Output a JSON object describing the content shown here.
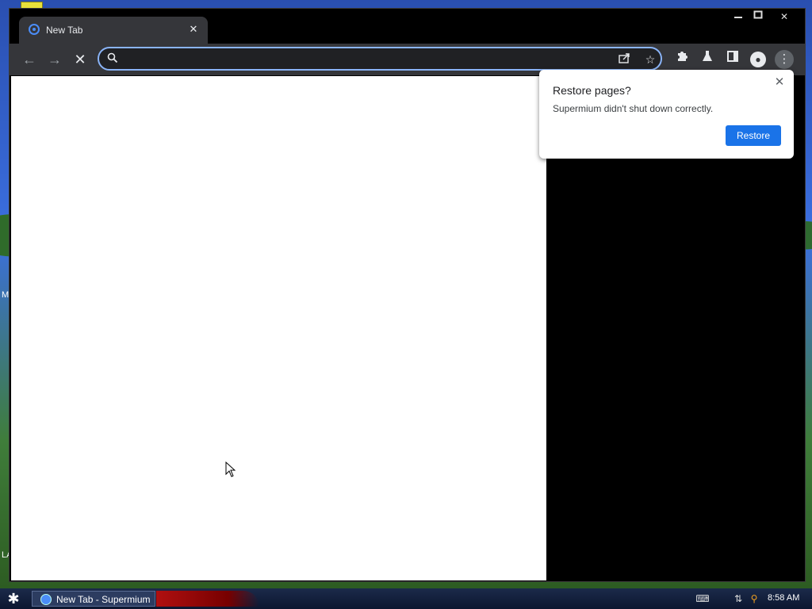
{
  "desktop": {
    "edge_labels": [
      "M",
      "LA"
    ]
  },
  "browser": {
    "tab": {
      "title": "New Tab",
      "favicon": "supermium-icon"
    },
    "window_controls": {
      "minimize_icon": "minimize-icon",
      "maximize_icon": "maximize-icon",
      "close_icon": "close-icon"
    },
    "toolbar": {
      "back_icon": "arrow-left-icon",
      "forward_icon": "arrow-right-icon",
      "stop_icon": "stop-icon",
      "omnibox": {
        "value": "",
        "search_icon": "search-icon"
      },
      "share_icon": "share-icon",
      "bookmark_icon": "star-icon",
      "extensions_icon": "puzzle-icon",
      "labs_icon": "flask-icon",
      "side_panel_icon": "side-panel-icon",
      "profile_icon": "avatar-icon",
      "menu_icon": "kebab-menu-icon"
    },
    "restore_popup": {
      "title": "Restore pages?",
      "message": "Supermium didn't shut down correctly.",
      "button_label": "Restore"
    }
  },
  "taskbar": {
    "start_icon": "star-icon",
    "task_label": "New Tab - Supermium",
    "clock": "8:58 AM",
    "tray_icons": [
      "keyboard-icon",
      "network-icon",
      "search-icon"
    ]
  },
  "colors": {
    "accent": "#1a73e8",
    "omnibox_focus": "#8ab4f8",
    "toolbar": "#35363a"
  }
}
